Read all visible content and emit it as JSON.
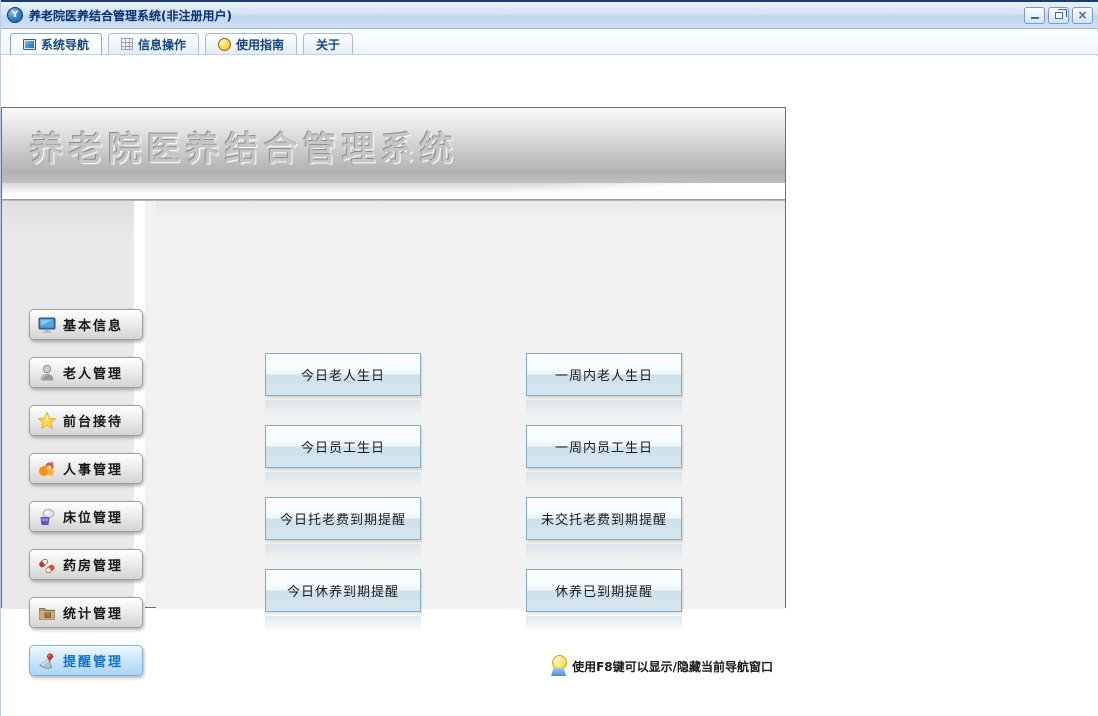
{
  "window": {
    "title": "养老院医养结合管理系统(非注册用户)",
    "app_icon": "app-logo-icon",
    "controls": [
      {
        "name": "minimize-button"
      },
      {
        "name": "restore-button"
      },
      {
        "name": "close-button"
      }
    ]
  },
  "tabs": [
    {
      "label": "系统导航",
      "icon": "monitor-icon",
      "active": true
    },
    {
      "label": "信息操作",
      "icon": "grid-icon",
      "active": false
    },
    {
      "label": "使用指南",
      "icon": "guide-icon",
      "active": false
    },
    {
      "label": "关于",
      "icon": "",
      "active": false
    }
  ],
  "panel": {
    "title": "养老院医养结合管理系统",
    "sidebar": [
      {
        "label": "基本信息",
        "icon": "monitor-icon",
        "active": false
      },
      {
        "label": "老人管理",
        "icon": "elderly-person-icon",
        "active": false
      },
      {
        "label": "前台接待",
        "icon": "star-icon",
        "active": false
      },
      {
        "label": "人事管理",
        "icon": "hr-person-icon",
        "active": false
      },
      {
        "label": "床位管理",
        "icon": "bed-icon",
        "active": false
      },
      {
        "label": "药房管理",
        "icon": "pills-icon",
        "active": false
      },
      {
        "label": "统计管理",
        "icon": "folder-icon",
        "active": false
      },
      {
        "label": "提醒管理",
        "icon": "megaphone-icon",
        "active": true
      }
    ],
    "reminder_buttons": [
      {
        "label": "今日老人生日"
      },
      {
        "label": "一周内老人生日"
      },
      {
        "label": "今日员工生日"
      },
      {
        "label": "一周内员工生日"
      },
      {
        "label": "今日托老费到期提醒"
      },
      {
        "label": "未交托老费到期提醒"
      },
      {
        "label": "今日休养到期提醒"
      },
      {
        "label": "休养已到期提醒"
      }
    ],
    "hint": {
      "icon": "lightbulb-icon",
      "text": "使用F8键可以显示/隐藏当前导航窗口"
    }
  },
  "colors": {
    "titlebar_accent": "#c2d7f0",
    "tab_text": "#17497d",
    "panel_header_text": "#c6c6c6",
    "button_border": "#85a9c0",
    "button_fill_bottom": "#cde1eb",
    "active_sidebar_text": "#1273cc",
    "active_sidebar_fill": "#abd4f6"
  }
}
